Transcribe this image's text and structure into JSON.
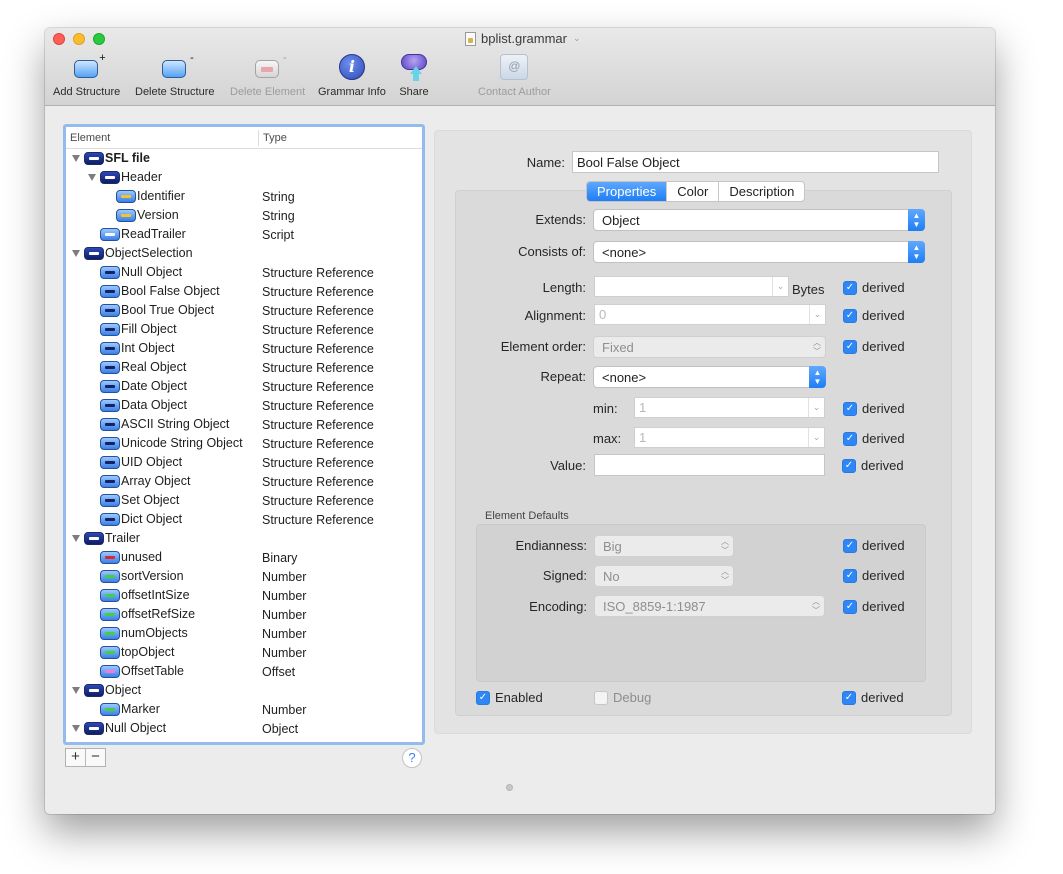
{
  "window": {
    "title": "bplist.grammar"
  },
  "toolbar": {
    "items": [
      {
        "label": "Add Structure",
        "icon": "add-structure-icon",
        "enabled": true
      },
      {
        "label": "Delete Structure",
        "icon": "delete-structure-icon",
        "enabled": true
      },
      {
        "label": "Delete Element",
        "icon": "delete-element-icon",
        "enabled": false
      },
      {
        "label": "Grammar Info",
        "icon": "info-icon",
        "enabled": true
      },
      {
        "label": "Share",
        "icon": "share-cloud-icon",
        "enabled": true
      },
      {
        "label": "Contact Author",
        "icon": "mail-icon",
        "enabled": false
      }
    ]
  },
  "tree": {
    "columns": {
      "element": "Element",
      "type": "Type"
    },
    "rows": [
      {
        "name": "SFL file",
        "type": "",
        "level": 0,
        "expanded": true,
        "icon": "structure",
        "bold": true
      },
      {
        "name": "Header",
        "type": "",
        "level": 1,
        "expanded": true,
        "icon": "structure"
      },
      {
        "name": "Identifier",
        "type": "String",
        "level": 2,
        "icon": "string"
      },
      {
        "name": "Version",
        "type": "String",
        "level": 2,
        "icon": "string"
      },
      {
        "name": "ReadTrailer",
        "type": "Script",
        "level": 1,
        "icon": "script"
      },
      {
        "name": "ObjectSelection",
        "type": "",
        "level": 0,
        "expanded": true,
        "icon": "structure"
      },
      {
        "name": "Null Object",
        "type": "Structure Reference",
        "level": 1,
        "icon": "reference"
      },
      {
        "name": "Bool False Object",
        "type": "Structure Reference",
        "level": 1,
        "icon": "reference"
      },
      {
        "name": "Bool True Object",
        "type": "Structure Reference",
        "level": 1,
        "icon": "reference"
      },
      {
        "name": "Fill Object",
        "type": "Structure Reference",
        "level": 1,
        "icon": "reference"
      },
      {
        "name": "Int Object",
        "type": "Structure Reference",
        "level": 1,
        "icon": "reference"
      },
      {
        "name": "Real Object",
        "type": "Structure Reference",
        "level": 1,
        "icon": "reference"
      },
      {
        "name": "Date Object",
        "type": "Structure Reference",
        "level": 1,
        "icon": "reference"
      },
      {
        "name": "Data Object",
        "type": "Structure Reference",
        "level": 1,
        "icon": "reference"
      },
      {
        "name": "ASCII String Object",
        "type": "Structure Reference",
        "level": 1,
        "icon": "reference"
      },
      {
        "name": "Unicode String Object",
        "type": "Structure Reference",
        "level": 1,
        "icon": "reference"
      },
      {
        "name": "UID Object",
        "type": "Structure Reference",
        "level": 1,
        "icon": "reference"
      },
      {
        "name": "Array Object",
        "type": "Structure Reference",
        "level": 1,
        "icon": "reference"
      },
      {
        "name": "Set Object",
        "type": "Structure Reference",
        "level": 1,
        "icon": "reference"
      },
      {
        "name": "Dict Object",
        "type": "Structure Reference",
        "level": 1,
        "icon": "reference"
      },
      {
        "name": "Trailer",
        "type": "",
        "level": 0,
        "expanded": true,
        "icon": "structure"
      },
      {
        "name": "unused",
        "type": "Binary",
        "level": 1,
        "icon": "binary"
      },
      {
        "name": "sortVersion",
        "type": "Number",
        "level": 1,
        "icon": "number"
      },
      {
        "name": "offsetIntSize",
        "type": "Number",
        "level": 1,
        "icon": "number"
      },
      {
        "name": "offsetRefSize",
        "type": "Number",
        "level": 1,
        "icon": "number"
      },
      {
        "name": "numObjects",
        "type": "Number",
        "level": 1,
        "icon": "number"
      },
      {
        "name": "topObject",
        "type": "Number",
        "level": 1,
        "icon": "number"
      },
      {
        "name": "OffsetTable",
        "type": "Offset",
        "level": 1,
        "icon": "offset"
      },
      {
        "name": "Object",
        "type": "",
        "level": 0,
        "expanded": true,
        "icon": "structure"
      },
      {
        "name": "Marker",
        "type": "Number",
        "level": 1,
        "icon": "number"
      },
      {
        "name": "Null Object",
        "type": "Object",
        "level": 0,
        "expanded": true,
        "icon": "structure"
      }
    ],
    "add_label": "+",
    "remove_label": "−",
    "help_label": "?"
  },
  "icon_colors": {
    "string": "#f2c52b",
    "script": "#f4f8ff",
    "reference": "#142266",
    "binary": "#e0262d",
    "number": "#3fd23f",
    "offset": "#f07adf",
    "structure": "#ffffff"
  },
  "detail": {
    "name_label": "Name:",
    "name_value": "Bool False Object",
    "tabs": [
      {
        "label": "Properties",
        "active": true
      },
      {
        "label": "Color",
        "active": false
      },
      {
        "label": "Description",
        "active": false
      }
    ],
    "extends_label": "Extends:",
    "extends_value": "Object",
    "consists_label": "Consists of:",
    "consists_value": "<none>",
    "length_label": "Length:",
    "length_value": "",
    "length_unit": "Bytes",
    "alignment_label": "Alignment:",
    "alignment_value": "0",
    "order_label": "Element order:",
    "order_value": "Fixed",
    "repeat_label": "Repeat:",
    "repeat_value": "<none>",
    "min_label": "min:",
    "min_value": "1",
    "max_label": "max:",
    "max_value": "1",
    "value_label": "Value:",
    "value_value": "",
    "derived_label": "derived",
    "defaults_title": "Element Defaults",
    "endianness_label": "Endianness:",
    "endianness_value": "Big",
    "signed_label": "Signed:",
    "signed_value": "No",
    "encoding_label": "Encoding:",
    "encoding_value": "ISO_8859-1:1987",
    "enabled_label": "Enabled",
    "enabled_checked": true,
    "debug_label": "Debug",
    "debug_checked": false
  }
}
